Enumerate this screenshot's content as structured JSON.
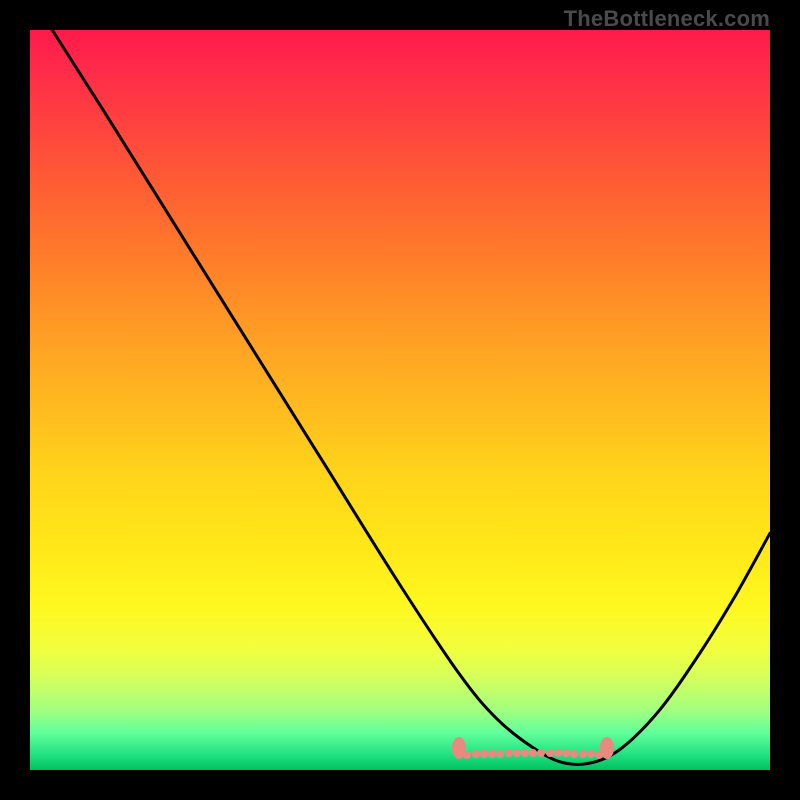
{
  "watermark": "TheBottleneck.com",
  "chart_data": {
    "type": "line",
    "title": "",
    "xlabel": "",
    "ylabel": "",
    "x_range": [
      0,
      100
    ],
    "y_range": [
      0,
      100
    ],
    "series": [
      {
        "name": "curve",
        "x": [
          3,
          10,
          20,
          30,
          40,
          50,
          58,
          63,
          68,
          72,
          76,
          80,
          85,
          90,
          95,
          100
        ],
        "values": [
          100,
          89,
          73,
          57,
          41,
          25,
          13,
          7,
          3,
          1,
          1,
          3,
          8,
          15,
          23,
          32
        ]
      }
    ],
    "highlight_band_x": [
      58,
      78
    ],
    "highlight_band_y": 3,
    "colors": {
      "curve": "#000000",
      "highlight": "#e88a80",
      "background_top": "#ff1a4a",
      "background_bottom": "#00c060",
      "frame": "#000000"
    }
  }
}
